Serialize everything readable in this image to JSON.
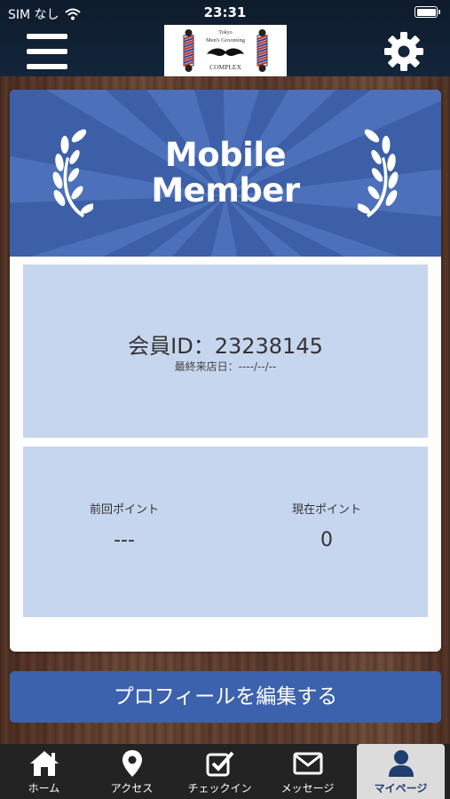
{
  "status": {
    "carrier": "SIM なし",
    "time": "23:31"
  },
  "header": {
    "logo": {
      "line1": "Tokyo",
      "line2": "Men's Grooming",
      "line3": "COMPLEX"
    }
  },
  "banner": {
    "title_line1": "Mobile",
    "title_line2": "Member"
  },
  "member": {
    "id_text": "会員ID：23238145",
    "last_visit": "最終来店日：----/--/--"
  },
  "points": {
    "previous_label": "前回ポイント",
    "previous_value": "---",
    "current_label": "現在ポイント",
    "current_value": "0"
  },
  "edit_profile_label": "プロフィールを編集する",
  "tabs": [
    {
      "label": "ホーム",
      "icon": "home-icon"
    },
    {
      "label": "アクセス",
      "icon": "map-pin-icon"
    },
    {
      "label": "チェックイン",
      "icon": "checkbox-icon"
    },
    {
      "label": "メッセージ",
      "icon": "envelope-icon"
    },
    {
      "label": "マイページ",
      "icon": "user-icon",
      "active": true
    }
  ],
  "colors": {
    "banner": "#3c5fa8",
    "panel": "#c6d6ee",
    "button": "#3c62ad",
    "tabbar": "#232323",
    "active_tab": "#dcdcdc"
  }
}
